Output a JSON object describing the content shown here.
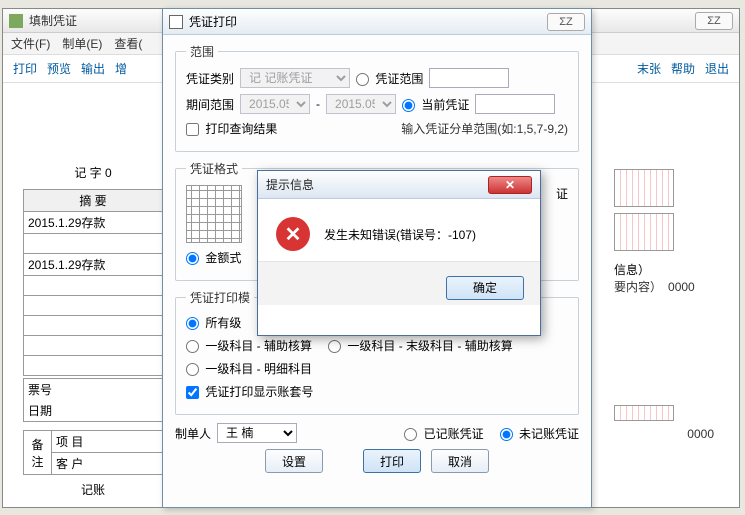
{
  "main_window": {
    "title": "填制凭证",
    "menus": [
      "文件(F)",
      "制单(E)",
      "查看("
    ],
    "toolbar_left": [
      "打印",
      "预览",
      "输出",
      "增"
    ],
    "toolbar_right": [
      "末张",
      "帮助",
      "退出"
    ],
    "voucher_label_prefix": "记   字   0",
    "summary_header": "摘  要",
    "rows": [
      "2015.1.29存款",
      "",
      "2015.1.29存款",
      "",
      "",
      "",
      "",
      ""
    ],
    "footer1": "票号",
    "footer2": "日期",
    "remark_label": "备注",
    "remark_row1": "项  目",
    "remark_row2": "客  户",
    "bottom_label": "记账",
    "right_info1": "信息）",
    "right_info2": "要内容）",
    "zeros": "0000"
  },
  "print_dialog": {
    "title": "凭证打印",
    "group_scope": {
      "legend": "范围",
      "category_label": "凭证类别",
      "category_value": "记 记账凭证",
      "period_label": "期间范围",
      "period_from": "2015.05",
      "period_to": "2015.05",
      "radio_scope": "凭证范围",
      "radio_current": "当前凭证",
      "chk_query": "打印查询结果",
      "hint": "输入凭证分单范围(如:1,5,7-9,2)"
    },
    "group_format": {
      "legend": "凭证格式",
      "radio_amount": "金额式",
      "text_tail": "证"
    },
    "group_template": {
      "legend": "凭证打印模",
      "radio_all": "所有级",
      "radio_lvl1_aux": "一级科目 - 辅助核算",
      "radio_lvl1_last_aux": "一级科目 - 末级科目 - 辅助核算",
      "radio_lvl1_detail": "一级科目 - 明细科目",
      "chk_show_acct": "凭证打印显示账套号"
    },
    "maker_label": "制单人",
    "maker_value": "王  楠",
    "radio_posted": "已记账凭证",
    "radio_unposted": "未记账凭证",
    "btn_settings": "设置",
    "btn_print": "打印",
    "btn_cancel": "取消"
  },
  "msg_dialog": {
    "title": "提示信息",
    "message": "发生未知错误(错误号：-107)",
    "btn_ok": "确定"
  }
}
